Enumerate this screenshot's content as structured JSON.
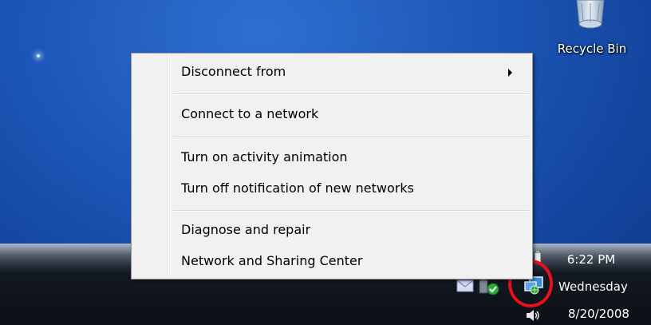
{
  "desktop": {
    "recycle_bin_label": "Recycle Bin"
  },
  "context_menu": {
    "items": [
      {
        "label": "Disconnect from",
        "has_submenu": true
      },
      {
        "label": "Connect to a network",
        "has_submenu": false
      },
      {
        "label": "Turn on activity animation",
        "has_submenu": false
      },
      {
        "label": "Turn off notification of new networks",
        "has_submenu": false
      },
      {
        "label": "Diagnose and repair",
        "has_submenu": false
      },
      {
        "label": "Network and Sharing Center",
        "has_submenu": false
      }
    ]
  },
  "taskbar": {
    "clock": {
      "time": "6:22 PM",
      "day": "Wednesday",
      "date": "8/20/2008"
    },
    "tray_icons": [
      "mail-icon",
      "windows-defender-icon",
      "network-icon",
      "volume-icon",
      "power-icon"
    ]
  },
  "colors": {
    "desktop_blue": "#1d58b8",
    "menu_background": "#f1f1f1",
    "highlight_circle": "#e8101a"
  }
}
